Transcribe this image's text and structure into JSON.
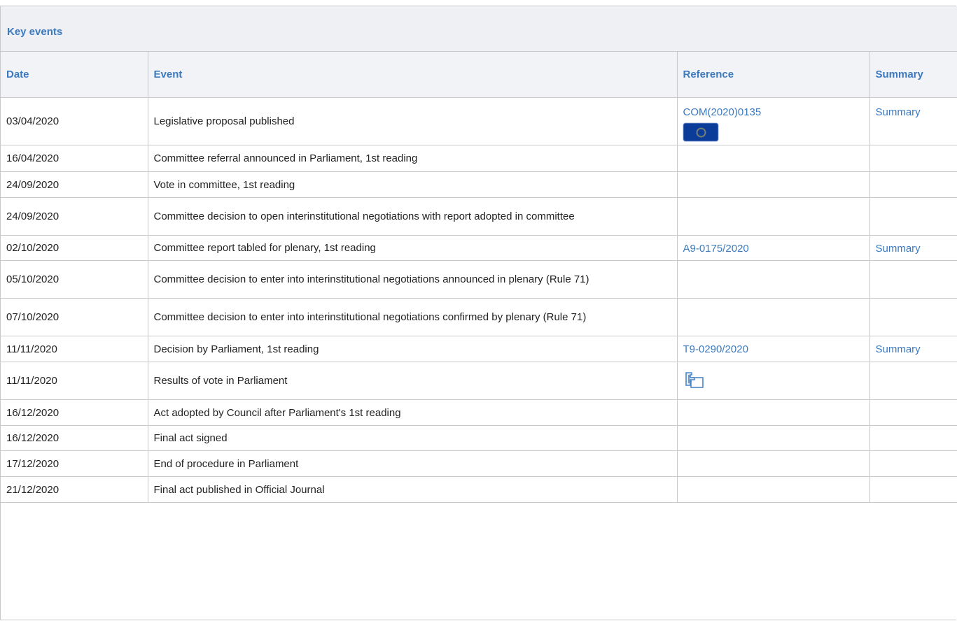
{
  "panel": {
    "title": "Key events"
  },
  "columns": {
    "date": "Date",
    "event": "Event",
    "reference": "Reference",
    "summary": "Summary"
  },
  "rows": [
    {
      "date": "03/04/2020",
      "event": "Legislative proposal published",
      "reference": "COM(2020)0135",
      "summary": "Summary"
    },
    {
      "date": "16/04/2020",
      "event": "Committee referral announced in Parliament, 1st reading",
      "reference": "",
      "summary": ""
    },
    {
      "date": "24/09/2020",
      "event": "Vote in committee, 1st reading",
      "reference": "",
      "summary": ""
    },
    {
      "date": "24/09/2020",
      "event": "Committee decision to open interinstitutional negotiations with report adopted in committee",
      "reference": "",
      "summary": ""
    },
    {
      "date": "02/10/2020",
      "event": "Committee report tabled for plenary, 1st reading",
      "reference": "A9-0175/2020",
      "summary": "Summary"
    },
    {
      "date": "05/10/2020",
      "event": "Committee decision to enter into interinstitutional negotiations announced in plenary (Rule 71)",
      "reference": "",
      "summary": ""
    },
    {
      "date": "07/10/2020",
      "event": "Committee decision to enter into interinstitutional negotiations confirmed by plenary (Rule 71)",
      "reference": "",
      "summary": ""
    },
    {
      "date": "11/11/2020",
      "event": "Decision by Parliament, 1st reading",
      "reference": "T9-0290/2020",
      "summary": "Summary"
    },
    {
      "date": "11/11/2020",
      "event": "Results of vote in Parliament",
      "reference": "",
      "summary": ""
    },
    {
      "date": "16/12/2020",
      "event": "Act adopted by Council after Parliament's 1st reading",
      "reference": "",
      "summary": ""
    },
    {
      "date": "16/12/2020",
      "event": "Final act signed",
      "reference": "",
      "summary": ""
    },
    {
      "date": "17/12/2020",
      "event": "End of procedure in Parliament",
      "reference": "",
      "summary": ""
    },
    {
      "date": "21/12/2020",
      "event": "Final act published in Official Journal",
      "reference": "",
      "summary": ""
    }
  ],
  "icons": {
    "row0_reference": "eu-flag-icon",
    "row8_reference": "vote-results-icon"
  },
  "colors": {
    "link": "#3b79c0",
    "header_bg": "#f2f3f6",
    "border": "#c8c8c8"
  }
}
